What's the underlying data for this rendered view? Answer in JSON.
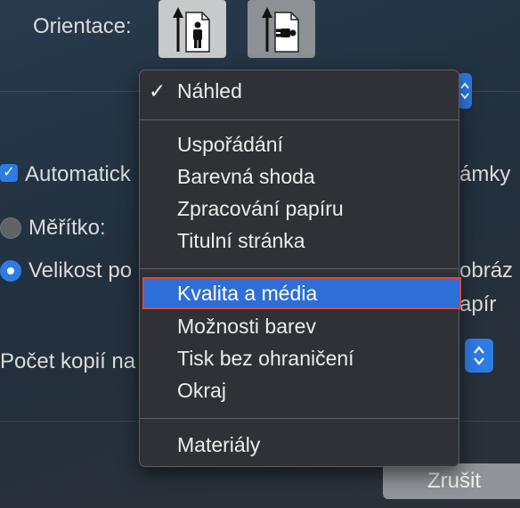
{
  "dialog": {
    "orientation_label": "Orientace:",
    "orientation_options": [
      {
        "name": "portrait",
        "icon": "portrait-person-icon",
        "selected": true
      },
      {
        "name": "landscape",
        "icon": "landscape-person-icon",
        "selected": false
      }
    ],
    "automatic_checkbox_label": "Automatick",
    "automatic_checked": true,
    "right_partial_1": "ámky",
    "scale_label": "Měřítko:",
    "fit_size_label": "Velikost po",
    "right_partial_2": "obráz",
    "right_partial_3": "apír",
    "copies_label": "Počet kopií na",
    "cancel_button": "Zrušit"
  },
  "menu": {
    "checked_item": "Náhled",
    "groups": [
      [
        "Náhled"
      ],
      [
        "Uspořádání",
        "Barevná shoda",
        "Zpracování papíru",
        "Titulní stránka"
      ],
      [
        "Kvalita a média",
        "Možnosti barev",
        "Tisk bez ohraničení",
        "Okraj"
      ],
      [
        "Materiály"
      ]
    ],
    "highlighted_item": "Kvalita a média"
  },
  "colors": {
    "accent": "#2d7be5",
    "highlight": "#2d6ed8",
    "highlight_outline": "#d64b45"
  }
}
